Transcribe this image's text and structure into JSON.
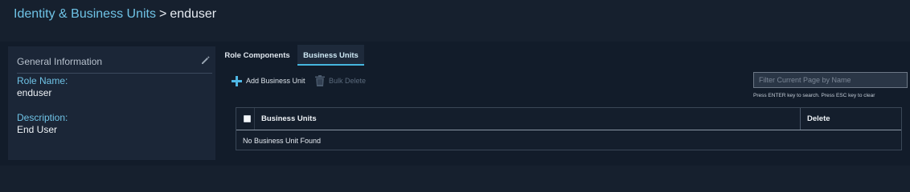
{
  "breadcrumb": {
    "parent": "Identity & Business Units",
    "separator": ">",
    "current": "enduser"
  },
  "info_panel": {
    "title": "General Information",
    "role_name_label": "Role Name:",
    "role_name_value": "enduser",
    "description_label": "Description:",
    "description_value": "End User"
  },
  "tabs": [
    {
      "label": "Role Components",
      "active": false
    },
    {
      "label": "Business Units",
      "active": true
    }
  ],
  "toolbar": {
    "add_label": "Add Business Unit",
    "bulk_delete_label": "Bulk Delete"
  },
  "filter": {
    "placeholder": "Filter Current Page by Name",
    "value": "",
    "hint": "Press ENTER key to search. Press ESC key to clear"
  },
  "table": {
    "headers": [
      "Business Units",
      "Delete"
    ],
    "empty_message": "No Business Unit Found"
  },
  "colors": {
    "accent": "#6fc3e6",
    "add_icon": "#4fb8e6",
    "background": "#16202e"
  },
  "icons": {
    "edit": "pencil-icon",
    "add": "plus-icon",
    "bulk_delete": "trash-icon"
  }
}
